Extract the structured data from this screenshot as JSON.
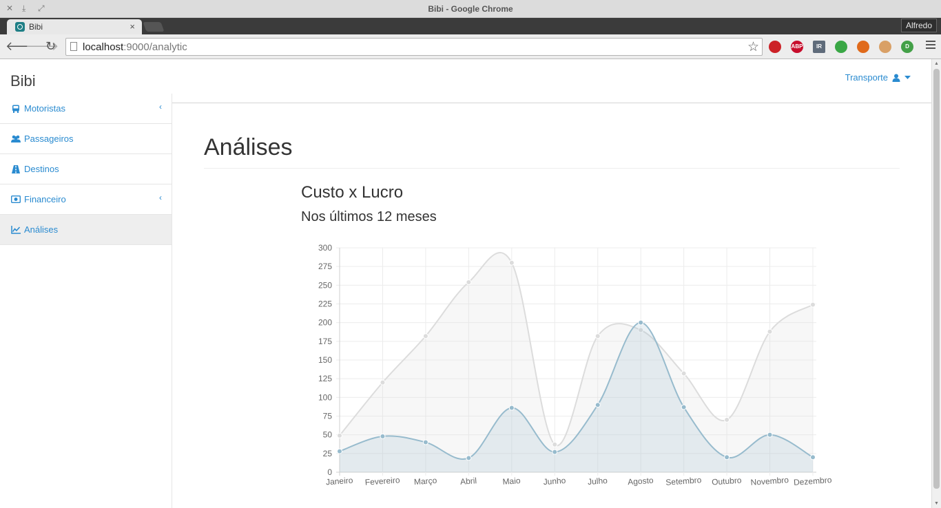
{
  "window": {
    "title": "Bibi - Google Chrome"
  },
  "browser": {
    "tab_title": "Bibi",
    "tab_close": "×",
    "profile_name": "Alfredo",
    "url_host": "localhost",
    "url_path": ":9000/analytic",
    "extensions": [
      {
        "name": "lastpass-icon",
        "color": "#cc2127"
      },
      {
        "name": "adblock-icon",
        "label": "ABP",
        "color": "#c70d2c"
      },
      {
        "name": "ir-icon",
        "label": "IR",
        "color": "#5f6b7a"
      },
      {
        "name": "evernote-icon",
        "color": "#3aa745"
      },
      {
        "name": "camera-icon",
        "color": "#e06a1b"
      },
      {
        "name": "robot-icon",
        "color": "#d9a066"
      },
      {
        "name": "pushbullet-icon",
        "label": "D",
        "color": "#43a047"
      }
    ]
  },
  "app": {
    "brand": "Bibi",
    "user_menu_label": "Transporte",
    "accent": "#2a8bd0"
  },
  "sidebar": {
    "items": [
      {
        "label": "Motoristas",
        "icon": "bus-icon",
        "expandable": true,
        "active": false
      },
      {
        "label": "Passageiros",
        "icon": "users-icon",
        "expandable": false,
        "active": false
      },
      {
        "label": "Destinos",
        "icon": "road-icon",
        "expandable": false,
        "active": false
      },
      {
        "label": "Financeiro",
        "icon": "money-icon",
        "expandable": true,
        "active": false
      },
      {
        "label": "Análises",
        "icon": "line-chart-icon",
        "expandable": false,
        "active": true
      }
    ]
  },
  "main": {
    "page_title": "Análises",
    "chart_title": "Custo x Lucro",
    "chart_subtitle": "Nos últimos 12 meses"
  },
  "chart_data": {
    "type": "line",
    "categories": [
      "Janeiro",
      "Fevereiro",
      "Março",
      "Abril",
      "Maio",
      "Junho",
      "Julho",
      "Agosto",
      "Setembro",
      "Outubro",
      "Novembro",
      "Dezembro"
    ],
    "series": [
      {
        "values": [
          49,
          120,
          182,
          254,
          280,
          37,
          182,
          190,
          132,
          70,
          188,
          224
        ],
        "color": "#dcdcdc",
        "fill": "rgba(220,220,220,0.22)"
      },
      {
        "values": [
          28,
          48,
          40,
          19,
          86,
          27,
          90,
          200,
          87,
          20,
          50,
          20
        ],
        "color": "#97bbcd",
        "fill": "rgba(151,187,205,0.20)"
      }
    ],
    "ylim": [
      0,
      300
    ],
    "yticks": [
      0,
      25,
      50,
      75,
      100,
      125,
      150,
      175,
      200,
      225,
      250,
      275,
      300
    ],
    "grid": true,
    "smooth": true
  }
}
